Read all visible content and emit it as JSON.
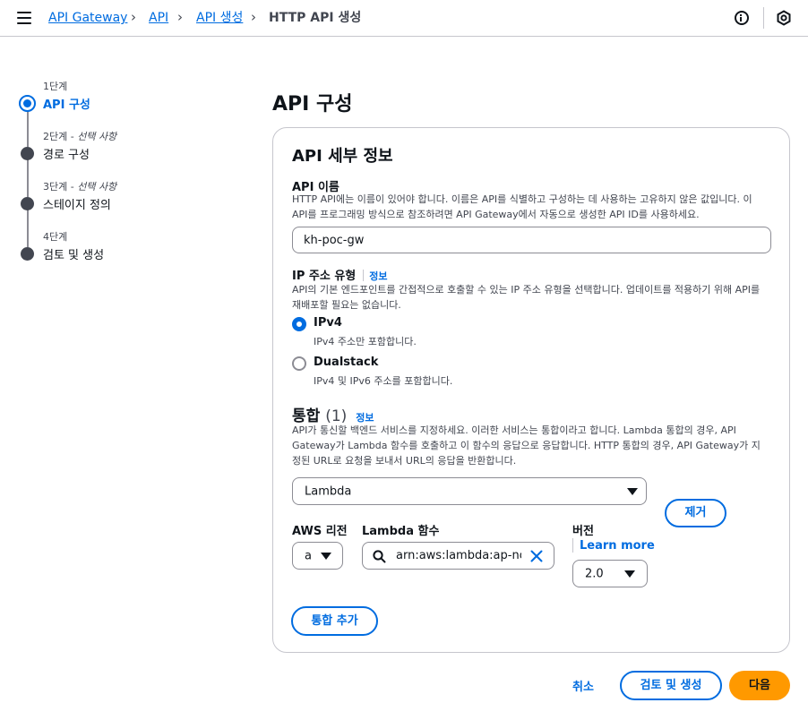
{
  "breadcrumbs": [
    {
      "label": "API Gateway"
    },
    {
      "label": "API"
    },
    {
      "label": "API 생성"
    },
    {
      "label": "HTTP API 생성"
    }
  ],
  "steps": [
    {
      "sub": "1단계",
      "optional": "",
      "label": "API 구성",
      "active": true
    },
    {
      "sub": "2단계 - ",
      "optional": "선택 사항",
      "label": "경로 구성",
      "active": false
    },
    {
      "sub": "3단계 - ",
      "optional": "선택 사항",
      "label": "스테이지 정의",
      "active": false
    },
    {
      "sub": "4단계",
      "optional": "",
      "label": "검토 및 생성",
      "active": false
    }
  ],
  "page_title": "API 구성",
  "details": {
    "title": "API 세부 정보",
    "api_name": {
      "label": "API 이름",
      "desc_line1": "HTTP API에는 이름이 있어야 합니다. 이름은 API를 식별하고 구성하는 데 사용하는 고유하지 않은 값입니다. 이",
      "desc_line2": "API를 프로그래밍 방식으로 참조하려면 API Gateway에서 자동으로 생성한 API ID를 사용하세요.",
      "value": "kh-poc-gw"
    },
    "ip_type": {
      "label": "IP 주소 유형",
      "info": "정보",
      "desc_line1": "API의 기본 엔드포인트를 간접적으로 호출할 수 있는 IP 주소 유형을 선택합니다. 업데이트를 적용하기 위해 API를",
      "desc_line2": "재배포할 필요는 없습니다.",
      "options": [
        {
          "label": "IPv4",
          "desc": "IPv4 주소만 포함합니다.",
          "selected": true
        },
        {
          "label": "Dualstack",
          "desc": "IPv4 및 IPv6 주소를 포함합니다.",
          "selected": false
        }
      ]
    },
    "integrations": {
      "title": "통합",
      "count": "(1)",
      "info": "정보",
      "desc_line1": "API가 통신할 백엔드 서비스를 지정하세요. 이러한 서비스는 통합이라고 합니다. Lambda 통합의 경우, API",
      "desc_line2": "Gateway가 Lambda 함수를 호출하고 이 함수의 응답으로 응답합니다. HTTP 통합의 경우, API Gateway가 지",
      "desc_line3": "정된 URL로 요청을 보내서 URL의 응답을 반환합니다.",
      "type_value": "Lambda",
      "remove_label": "제거",
      "region_label": "AWS 리전",
      "region_value": "a",
      "function_label": "Lambda 함수",
      "function_value": "arn:aws:lambda:ap-no",
      "version_label": "버전",
      "learn_more": "Learn more",
      "version_value": "2.0",
      "add_label": "통합 추가"
    }
  },
  "footer": {
    "cancel": "취소",
    "review_create": "검토 및 생성",
    "next": "다음"
  }
}
